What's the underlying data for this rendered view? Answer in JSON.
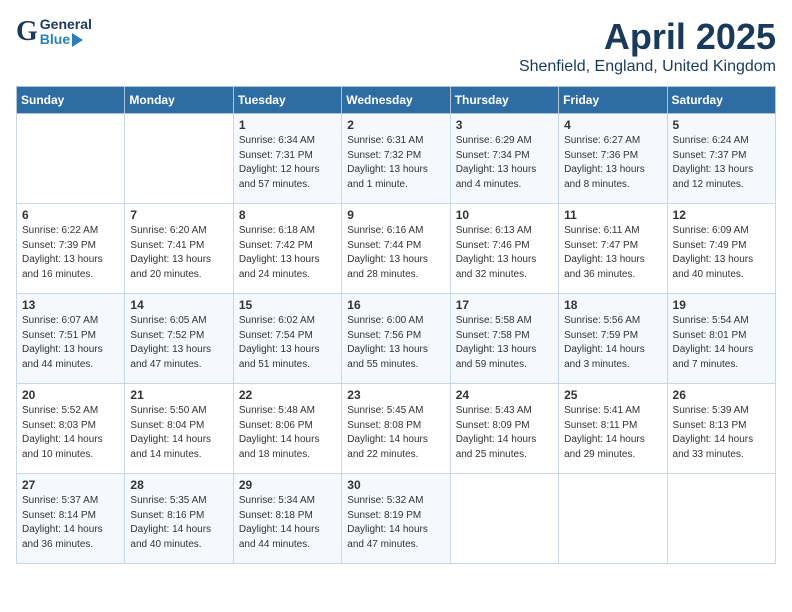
{
  "header": {
    "logo_general": "General",
    "logo_blue": "Blue",
    "title": "April 2025",
    "subtitle": "Shenfield, England, United Kingdom"
  },
  "calendar": {
    "weekdays": [
      "Sunday",
      "Monday",
      "Tuesday",
      "Wednesday",
      "Thursday",
      "Friday",
      "Saturday"
    ],
    "weeks": [
      [
        {
          "day": "",
          "info": ""
        },
        {
          "day": "",
          "info": ""
        },
        {
          "day": "1",
          "info": "Sunrise: 6:34 AM\nSunset: 7:31 PM\nDaylight: 12 hours\nand 57 minutes."
        },
        {
          "day": "2",
          "info": "Sunrise: 6:31 AM\nSunset: 7:32 PM\nDaylight: 13 hours\nand 1 minute."
        },
        {
          "day": "3",
          "info": "Sunrise: 6:29 AM\nSunset: 7:34 PM\nDaylight: 13 hours\nand 4 minutes."
        },
        {
          "day": "4",
          "info": "Sunrise: 6:27 AM\nSunset: 7:36 PM\nDaylight: 13 hours\nand 8 minutes."
        },
        {
          "day": "5",
          "info": "Sunrise: 6:24 AM\nSunset: 7:37 PM\nDaylight: 13 hours\nand 12 minutes."
        }
      ],
      [
        {
          "day": "6",
          "info": "Sunrise: 6:22 AM\nSunset: 7:39 PM\nDaylight: 13 hours\nand 16 minutes."
        },
        {
          "day": "7",
          "info": "Sunrise: 6:20 AM\nSunset: 7:41 PM\nDaylight: 13 hours\nand 20 minutes."
        },
        {
          "day": "8",
          "info": "Sunrise: 6:18 AM\nSunset: 7:42 PM\nDaylight: 13 hours\nand 24 minutes."
        },
        {
          "day": "9",
          "info": "Sunrise: 6:16 AM\nSunset: 7:44 PM\nDaylight: 13 hours\nand 28 minutes."
        },
        {
          "day": "10",
          "info": "Sunrise: 6:13 AM\nSunset: 7:46 PM\nDaylight: 13 hours\nand 32 minutes."
        },
        {
          "day": "11",
          "info": "Sunrise: 6:11 AM\nSunset: 7:47 PM\nDaylight: 13 hours\nand 36 minutes."
        },
        {
          "day": "12",
          "info": "Sunrise: 6:09 AM\nSunset: 7:49 PM\nDaylight: 13 hours\nand 40 minutes."
        }
      ],
      [
        {
          "day": "13",
          "info": "Sunrise: 6:07 AM\nSunset: 7:51 PM\nDaylight: 13 hours\nand 44 minutes."
        },
        {
          "day": "14",
          "info": "Sunrise: 6:05 AM\nSunset: 7:52 PM\nDaylight: 13 hours\nand 47 minutes."
        },
        {
          "day": "15",
          "info": "Sunrise: 6:02 AM\nSunset: 7:54 PM\nDaylight: 13 hours\nand 51 minutes."
        },
        {
          "day": "16",
          "info": "Sunrise: 6:00 AM\nSunset: 7:56 PM\nDaylight: 13 hours\nand 55 minutes."
        },
        {
          "day": "17",
          "info": "Sunrise: 5:58 AM\nSunset: 7:58 PM\nDaylight: 13 hours\nand 59 minutes."
        },
        {
          "day": "18",
          "info": "Sunrise: 5:56 AM\nSunset: 7:59 PM\nDaylight: 14 hours\nand 3 minutes."
        },
        {
          "day": "19",
          "info": "Sunrise: 5:54 AM\nSunset: 8:01 PM\nDaylight: 14 hours\nand 7 minutes."
        }
      ],
      [
        {
          "day": "20",
          "info": "Sunrise: 5:52 AM\nSunset: 8:03 PM\nDaylight: 14 hours\nand 10 minutes."
        },
        {
          "day": "21",
          "info": "Sunrise: 5:50 AM\nSunset: 8:04 PM\nDaylight: 14 hours\nand 14 minutes."
        },
        {
          "day": "22",
          "info": "Sunrise: 5:48 AM\nSunset: 8:06 PM\nDaylight: 14 hours\nand 18 minutes."
        },
        {
          "day": "23",
          "info": "Sunrise: 5:45 AM\nSunset: 8:08 PM\nDaylight: 14 hours\nand 22 minutes."
        },
        {
          "day": "24",
          "info": "Sunrise: 5:43 AM\nSunset: 8:09 PM\nDaylight: 14 hours\nand 25 minutes."
        },
        {
          "day": "25",
          "info": "Sunrise: 5:41 AM\nSunset: 8:11 PM\nDaylight: 14 hours\nand 29 minutes."
        },
        {
          "day": "26",
          "info": "Sunrise: 5:39 AM\nSunset: 8:13 PM\nDaylight: 14 hours\nand 33 minutes."
        }
      ],
      [
        {
          "day": "27",
          "info": "Sunrise: 5:37 AM\nSunset: 8:14 PM\nDaylight: 14 hours\nand 36 minutes."
        },
        {
          "day": "28",
          "info": "Sunrise: 5:35 AM\nSunset: 8:16 PM\nDaylight: 14 hours\nand 40 minutes."
        },
        {
          "day": "29",
          "info": "Sunrise: 5:34 AM\nSunset: 8:18 PM\nDaylight: 14 hours\nand 44 minutes."
        },
        {
          "day": "30",
          "info": "Sunrise: 5:32 AM\nSunset: 8:19 PM\nDaylight: 14 hours\nand 47 minutes."
        },
        {
          "day": "",
          "info": ""
        },
        {
          "day": "",
          "info": ""
        },
        {
          "day": "",
          "info": ""
        }
      ]
    ]
  }
}
